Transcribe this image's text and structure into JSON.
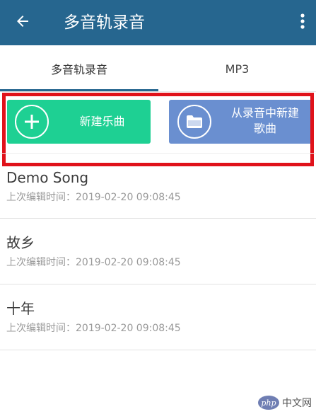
{
  "app_bar": {
    "title": "多音轨录音",
    "back_icon": "arrow-left-icon",
    "more_icon": "more-vertical-icon",
    "color": "#26668f"
  },
  "tabs": [
    {
      "label": "多音轨录音",
      "selected": true
    },
    {
      "label": "MP3",
      "selected": false
    }
  ],
  "actions": {
    "new_song": {
      "label": "新建乐曲",
      "icon": "plus-circle-icon",
      "color": "#1ed093"
    },
    "import_from_recording": {
      "label_line1": "从录音中新建",
      "label_line2": "歌曲",
      "icon": "folder-icon",
      "color": "#6a8fd0"
    },
    "highlight_color": "#e0121a"
  },
  "songs": [
    {
      "title": "Demo Song",
      "edited": "上次编辑时间：2019-02-20 09:08:45"
    },
    {
      "title": "故乡",
      "edited": "上次编辑时间：2019-02-20 09:08:45"
    },
    {
      "title": "十年",
      "edited": "上次编辑时间：2019-02-20 09:08:45"
    }
  ],
  "watermark": {
    "logo": "php",
    "text": "中文网"
  }
}
